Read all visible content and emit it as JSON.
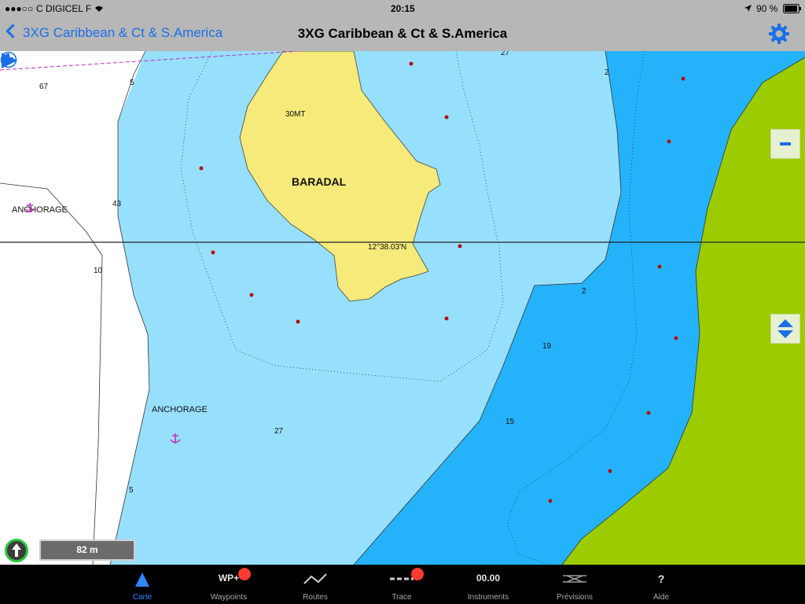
{
  "status_bar": {
    "carrier": "C DIGICEL F",
    "time": "20:15",
    "battery": "90 %"
  },
  "nav": {
    "back_label": "3XG Caribbean & Ct & S.America",
    "title": "3XG Caribbean & Ct & S.America"
  },
  "map": {
    "island_name": "BARADAL",
    "island_height": "30MT",
    "latitude_label": "12°38.03'N",
    "anchorage_labels": [
      "ANCHORAGE",
      "ANCHORAGE"
    ],
    "depth_soundings": [
      "67",
      "5",
      "43",
      "10",
      "5",
      "27",
      "2",
      "2",
      "19",
      "15",
      "27"
    ],
    "scale": "82 m",
    "colors": {
      "land": "#f5ea7a",
      "coast_land": "#9ccc00",
      "shallow_water": "#97e0fd",
      "deep_channel": "#24b3fb",
      "deep_water": "#ffffff",
      "anchor": "#c02ac6"
    }
  },
  "controls": {
    "play_icon": "play-icon",
    "add_icon": "plus-icon",
    "zoom_out_icon": "minus-icon",
    "layer_icon": "up-down-arrows-icon",
    "north_icon": "north-arrow-icon",
    "info_icon": "info-icon",
    "settings_icon": "gear-icon"
  },
  "tabs": [
    {
      "label": "Carte",
      "active": true
    },
    {
      "label": "Waypoints",
      "icon_text": "WP+"
    },
    {
      "label": "Routes"
    },
    {
      "label": "Trace"
    },
    {
      "label": "Instruments",
      "icon_text": "00.00"
    },
    {
      "label": "Prévisions"
    },
    {
      "label": "Aide",
      "icon_text": "?"
    }
  ]
}
